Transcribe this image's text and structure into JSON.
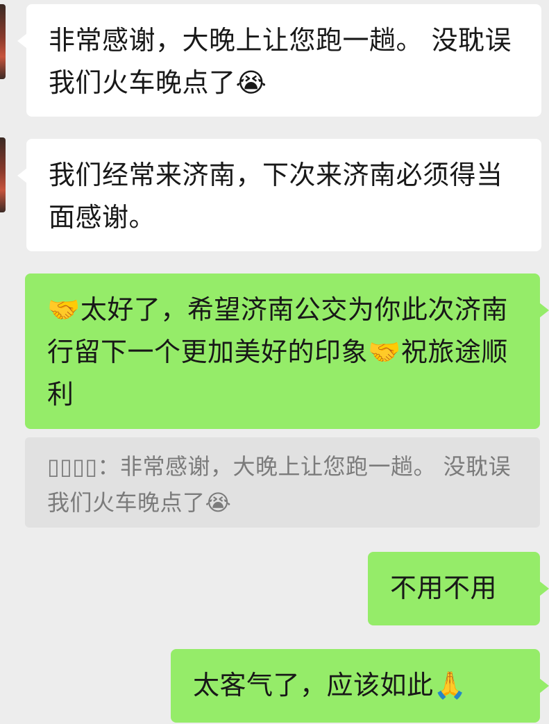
{
  "messages": [
    {
      "side": "in",
      "text": "非常感谢，大晚上让您跑一趟。 没耽误 我们火车晚点了😭"
    },
    {
      "side": "in",
      "text": "我们经常来济南，下次来济南必须得当面感谢。"
    },
    {
      "side": "out",
      "text": "🤝太好了，希望济南公交为你此次济南行留下一个更加美好的印象🤝祝旅途顺利"
    },
    {
      "side": "quote",
      "sender": "▯▯▯▯",
      "text": "：非常感谢，大晚上让您跑一趟。 没耽误 我们火车晚点了😭"
    },
    {
      "side": "out",
      "text": "不用不用"
    },
    {
      "side": "out",
      "text": "太客气了，应该如此🙏"
    }
  ]
}
